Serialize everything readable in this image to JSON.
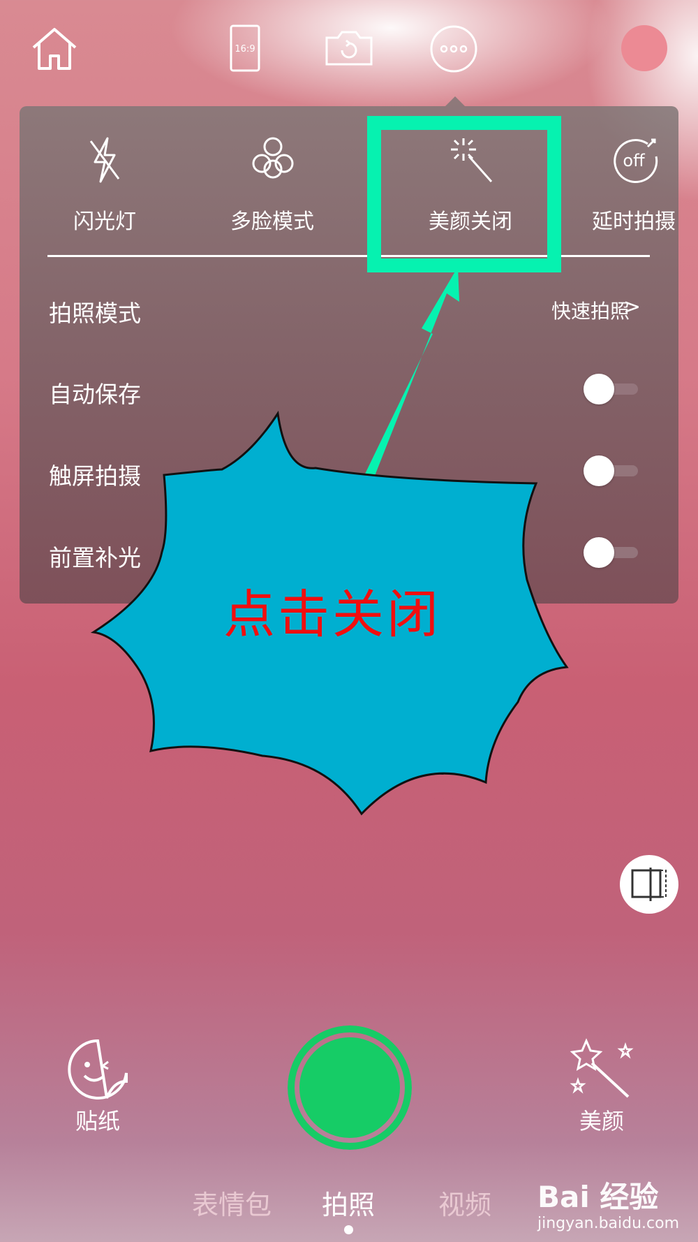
{
  "popup_menu": {
    "quick_toggles": [
      {
        "label": "闪光灯",
        "icon": "flash-off-icon"
      },
      {
        "label": "多脸模式",
        "icon": "multi-face-icon"
      },
      {
        "label": "美颜关闭",
        "icon": "beauty-wand-icon"
      },
      {
        "label": "延时拍摄",
        "icon": "timer-off-icon",
        "icon_text": "off"
      }
    ],
    "settings": [
      {
        "label": "拍照模式",
        "value": "快速拍照",
        "chevron": ">"
      },
      {
        "label": "自动保存",
        "toggle": false
      },
      {
        "label": "触屏拍摄",
        "toggle": false
      },
      {
        "label": "前置补光",
        "toggle": false
      }
    ]
  },
  "annotation": {
    "callout_text": "点击关闭",
    "highlight_color": "#06f2b0",
    "callout_fill": "#00afd0",
    "callout_text_color": "#f20e0e"
  },
  "top_bar": {
    "ratio_label": "16:9"
  },
  "bottom_bar": {
    "sticker_label": "贴纸",
    "beauty_label": "美颜",
    "shutter_color": "#16cc66"
  },
  "mode_tabs": [
    {
      "label": "表情包",
      "active": false
    },
    {
      "label": "拍照",
      "active": true
    },
    {
      "label": "视频",
      "active": false
    }
  ],
  "watermark": {
    "brand": "Bai 经验",
    "url": "jingyan.baidu.com"
  }
}
